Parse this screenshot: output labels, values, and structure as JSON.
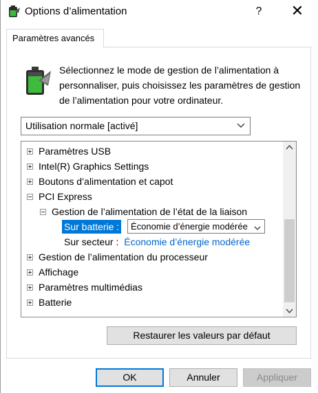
{
  "window": {
    "title": "Options d’alimentation",
    "help": "?",
    "close": "✕"
  },
  "tabs": [
    {
      "label": "Paramètres avancés"
    }
  ],
  "intro": "Sélectionnez le mode de gestion de l’alimentation à personnaliser, puis choisissez les paramètres de gestion de l’alimentation pour votre ordinateur.",
  "plan": {
    "selected": "Utilisation normale [activé]"
  },
  "tree": {
    "usb": "Paramètres USB",
    "intel": "Intel(R) Graphics Settings",
    "buttons": "Boutons d’alimentation et capot",
    "pci": "PCI Express",
    "link_state": "Gestion de l’alimentation de l’état de la liaison",
    "battery_label": "Sur batterie :",
    "battery_value": "Économie d’énergie modérée",
    "ac_label": "Sur secteur :",
    "ac_value": "Économie d’énergie modérée",
    "processor": "Gestion de l’alimentation du processeur",
    "display": "Affichage",
    "multimedia": "Paramètres multimédias",
    "battery": "Batterie"
  },
  "buttons": {
    "restore": "Restaurer les valeurs par défaut",
    "ok": "OK",
    "cancel": "Annuler",
    "apply": "Appliquer"
  },
  "colors": {
    "accent": "#0078d7",
    "link": "#0066cc",
    "battery_green": "#3dbb3d"
  }
}
